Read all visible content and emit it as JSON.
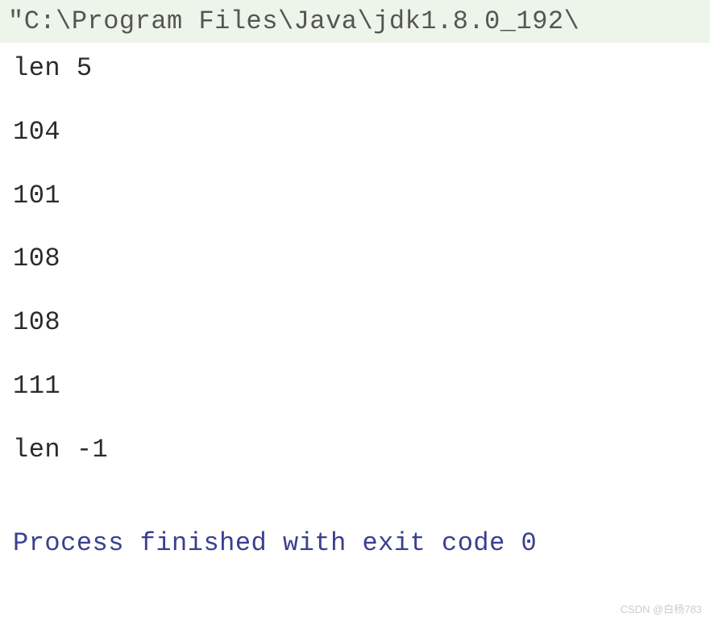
{
  "console": {
    "command": "\"C:\\Program Files\\Java\\jdk1.8.0_192\\",
    "output_lines": [
      "len 5",
      "104",
      "101",
      "108",
      "108",
      "111",
      "len -1"
    ],
    "exit_message": "Process finished with exit code 0"
  },
  "watermark": "CSDN @白杨783"
}
